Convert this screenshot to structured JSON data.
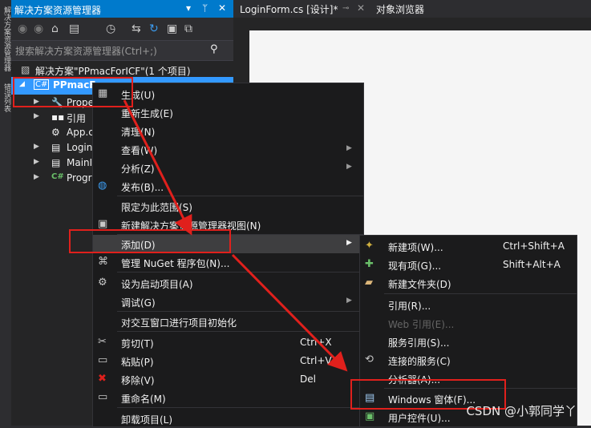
{
  "vertical_strip": {
    "label1": "解决方案资源管理器",
    "label2": "错误列表"
  },
  "solution_explorer": {
    "title": "解决方案资源管理器",
    "search_placeholder": "搜索解决方案资源管理器(Ctrl+;)",
    "tree": [
      {
        "label": "解决方案\"PPmacForICF\"(1 个项目)"
      },
      {
        "label": "PPmacF"
      },
      {
        "label": "Prope"
      },
      {
        "label": "引用"
      },
      {
        "label": "App.c"
      },
      {
        "label": "Login"
      },
      {
        "label": "MainI"
      },
      {
        "label": "Progr"
      }
    ]
  },
  "editor": {
    "tabs": [
      {
        "label": "LoginForm.cs [设计]*"
      },
      {
        "label": "对象浏览器"
      }
    ]
  },
  "context_menu": {
    "items": [
      {
        "label": "生成(U)"
      },
      {
        "label": "重新生成(E)"
      },
      {
        "label": "清理(N)"
      },
      {
        "label": "查看(W)"
      },
      {
        "label": "分析(Z)"
      },
      {
        "label": "发布(B)..."
      },
      {
        "label": "限定为此范围(S)"
      },
      {
        "label": "新建解决方案资源管理器视图(N)"
      },
      {
        "label": "添加(D)"
      },
      {
        "label": "管理 NuGet 程序包(N)..."
      },
      {
        "label": "设为启动项目(A)"
      },
      {
        "label": "调试(G)"
      },
      {
        "label": "对交互窗口进行项目初始化"
      },
      {
        "label": "剪切(T)",
        "shortcut": "Ctrl+X"
      },
      {
        "label": "粘贴(P)",
        "shortcut": "Ctrl+V"
      },
      {
        "label": "移除(V)",
        "shortcut": "Del"
      },
      {
        "label": "重命名(M)"
      },
      {
        "label": "卸载项目(L)"
      }
    ]
  },
  "add_submenu": {
    "items": [
      {
        "label": "新建项(W)...",
        "shortcut": "Ctrl+Shift+A"
      },
      {
        "label": "现有项(G)...",
        "shortcut": "Shift+Alt+A"
      },
      {
        "label": "新建文件夹(D)"
      },
      {
        "label": "引用(R)..."
      },
      {
        "label": "Web 引用(E)..."
      },
      {
        "label": "服务引用(S)..."
      },
      {
        "label": "连接的服务(C)"
      },
      {
        "label": "分析器(A)..."
      },
      {
        "label": "Windows 窗体(F)..."
      },
      {
        "label": "用户控件(U)..."
      }
    ]
  },
  "watermark": "CSDN @小郭同学丫",
  "colors": {
    "accent": "#007acc",
    "annotation": "#e0201c",
    "menu_bg": "#1b1b1c"
  }
}
